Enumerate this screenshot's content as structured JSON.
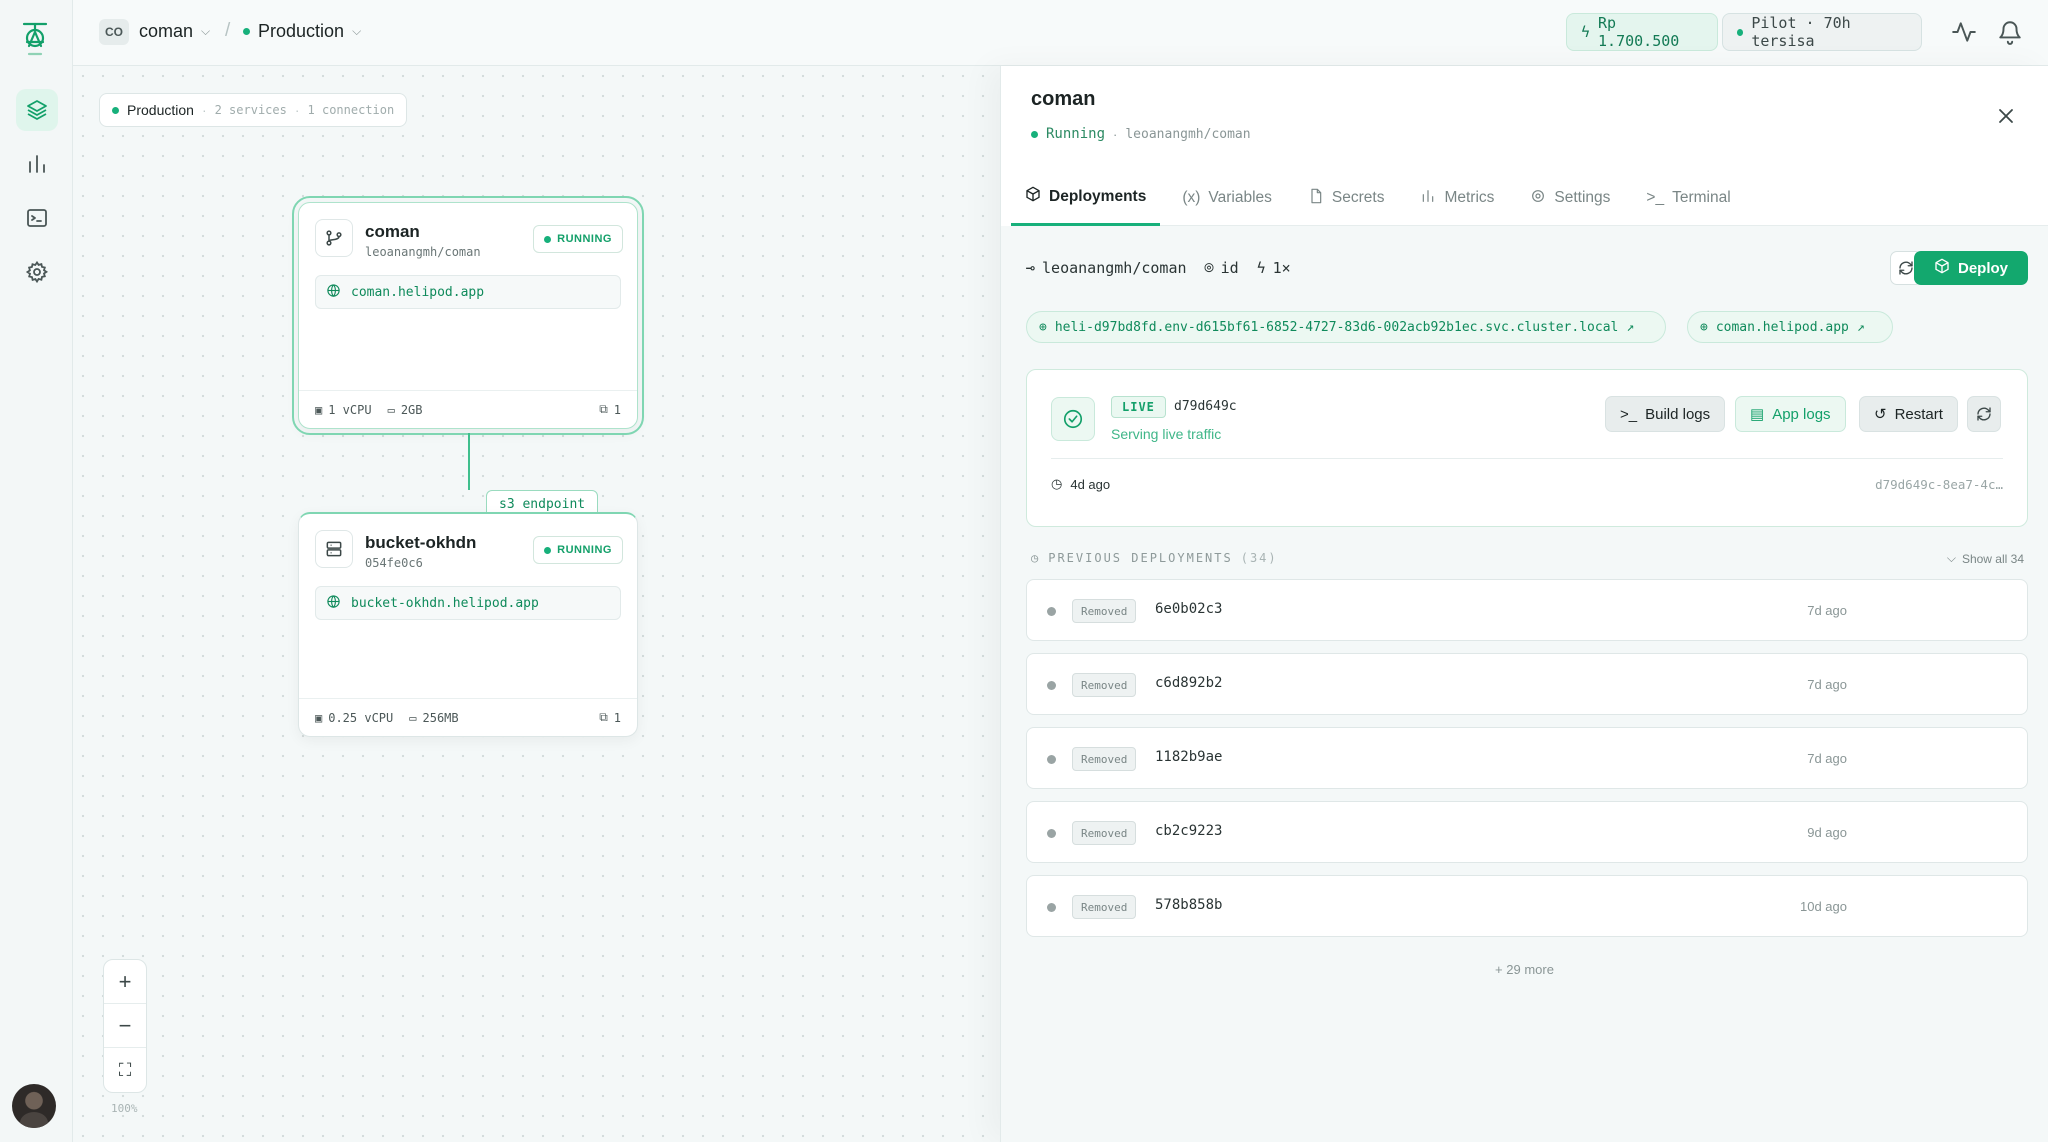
{
  "topbar": {
    "workspace_badge": "CO",
    "project_name": "coman",
    "environment": "Production",
    "credit": "Rp 1.700.500",
    "plan": "Pilot · 70h tersisa"
  },
  "canvas": {
    "env_chip": {
      "name": "Production",
      "services": "2 services",
      "connections": "1 connection"
    },
    "services": [
      {
        "name": "coman",
        "subtitle": "leoanangmh/coman",
        "status": "RUNNING",
        "url": "coman.helipod.app",
        "cpu": "1 vCPU",
        "memory": "2GB",
        "replicas": "1"
      },
      {
        "name": "bucket-okhdn",
        "subtitle": "054fe0c6",
        "status": "RUNNING",
        "url": "bucket-okhdn.helipod.app",
        "cpu": "0.25 vCPU",
        "memory": "256MB",
        "replicas": "1"
      }
    ],
    "edge_label": "s3 endpoint",
    "zoom": {
      "in": "+",
      "out": "−",
      "fit": "⛶",
      "level": "100%"
    }
  },
  "panel": {
    "title": "coman",
    "status": "Running",
    "repo": "leoanangmh/coman",
    "tabs": [
      {
        "label": "Deployments",
        "icon": "cube-icon",
        "active": true
      },
      {
        "label": "Variables",
        "icon": "variable-icon",
        "active": false
      },
      {
        "label": "Secrets",
        "icon": "file-icon",
        "active": false
      },
      {
        "label": "Metrics",
        "icon": "bar-chart-icon",
        "active": false
      },
      {
        "label": "Settings",
        "icon": "gear-icon",
        "active": false
      },
      {
        "label": "Terminal",
        "icon": "terminal-icon",
        "active": false
      }
    ],
    "meta": {
      "repo": "leoanangmh/coman",
      "region": "id",
      "replicas": "1×"
    },
    "deploy_label": "Deploy",
    "urls": [
      "heli-d97bd8fd.env-d615bf61-6852-4727-83d6-002acb92b1ec.svc.cluster.local",
      "coman.helipod.app"
    ],
    "live": {
      "badge": "LIVE",
      "commit": "d79d649c",
      "note": "Serving live traffic",
      "age": "4d ago",
      "id": "d79d649c-8ea7-4c…",
      "build_logs": "Build logs",
      "app_logs": "App logs",
      "restart": "Restart"
    },
    "previous": {
      "label": "PREVIOUS DEPLOYMENTS",
      "count": "(34)",
      "show_all": "Show all 34",
      "items": [
        {
          "status": "Removed",
          "hash": "6e0b02c3",
          "age": "7d ago"
        },
        {
          "status": "Removed",
          "hash": "c6d892b2",
          "age": "7d ago"
        },
        {
          "status": "Removed",
          "hash": "1182b9ae",
          "age": "7d ago"
        },
        {
          "status": "Removed",
          "hash": "cb2c9223",
          "age": "9d ago"
        },
        {
          "status": "Removed",
          "hash": "578b858b",
          "age": "10d ago"
        }
      ],
      "more": "+ 29 more"
    }
  },
  "colors": {
    "accent": "#13a86e",
    "accent_light": "#ecf8f2",
    "removed": "#9aa4a4"
  }
}
